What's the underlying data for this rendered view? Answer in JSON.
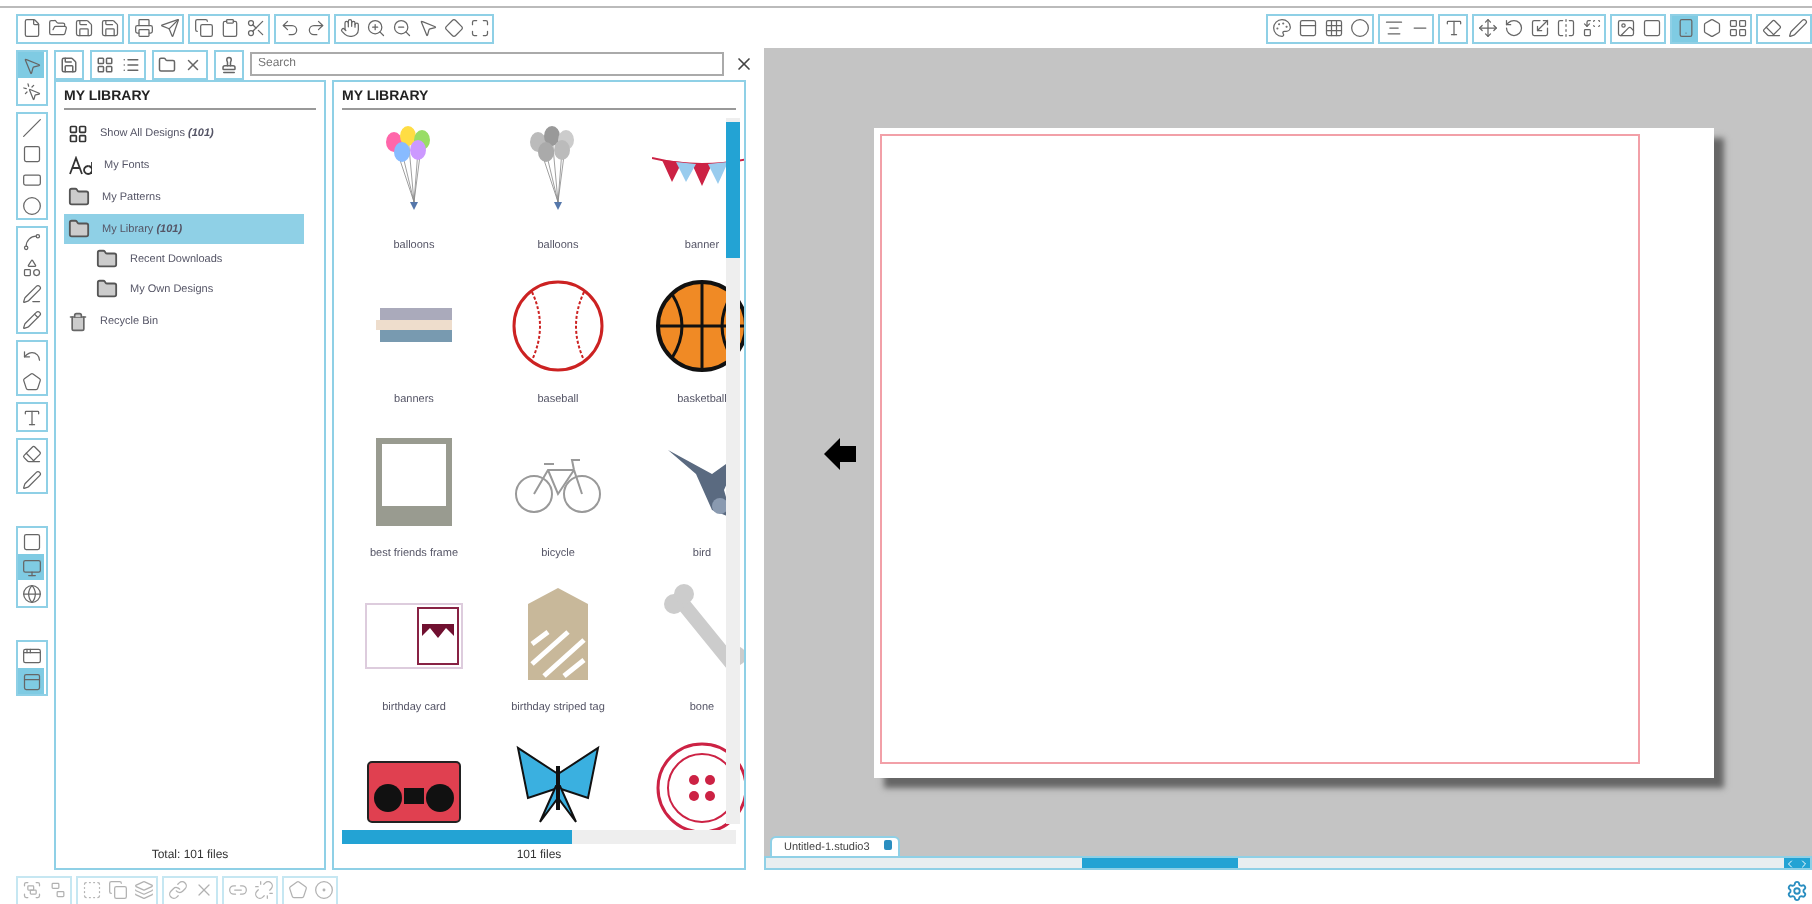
{
  "toolbar_top_left": [
    [
      {
        "selected": false
      },
      {
        "selected": false
      },
      {
        "selected": false
      },
      {
        "selected": false
      }
    ],
    [
      {
        "selected": false
      },
      {
        "selected": false
      }
    ],
    [
      {
        "selected": false
      },
      {
        "selected": false
      },
      {
        "selected": false
      }
    ],
    [
      {
        "selected": false
      },
      {
        "selected": false
      }
    ],
    [
      {
        "selected": false
      },
      {
        "selected": false
      },
      {
        "selected": false
      },
      {
        "selected": false
      },
      {
        "selected": false
      },
      {
        "selected": false
      }
    ]
  ],
  "toolbar_top_right": [
    [
      {
        "selected": false
      },
      {
        "selected": false
      },
      {
        "selected": false
      },
      {
        "selected": false
      }
    ],
    [
      {
        "selected": false
      },
      {
        "selected": false
      }
    ],
    [
      {
        "selected": false
      }
    ],
    [
      {
        "selected": false
      },
      {
        "selected": false
      },
      {
        "selected": false
      },
      {
        "selected": false
      },
      {
        "selected": false
      }
    ],
    [
      {
        "selected": false
      },
      {
        "selected": false
      }
    ],
    [
      {
        "selected": true
      },
      {
        "selected": false
      },
      {
        "selected": false
      }
    ],
    [
      {
        "selected": false
      },
      {
        "selected": false
      }
    ]
  ],
  "tool_strip": [
    [
      {
        "selected": true
      },
      {
        "selected": false
      }
    ],
    [
      {
        "selected": false
      },
      {
        "selected": false
      },
      {
        "selected": false
      },
      {
        "selected": false
      }
    ],
    [
      {
        "selected": false
      },
      {
        "selected": false
      },
      {
        "selected": false
      },
      {
        "selected": false
      }
    ],
    [
      {
        "selected": false
      },
      {
        "selected": false
      }
    ],
    [
      {
        "selected": false
      }
    ],
    [
      {
        "selected": false
      },
      {
        "selected": false
      }
    ],
    [
      {
        "selected": false
      },
      {
        "selected": true
      },
      {
        "selected": false
      }
    ],
    [
      {
        "selected": false
      },
      {
        "selected": true
      }
    ]
  ],
  "search": {
    "placeholder": "Search"
  },
  "library_tree": {
    "title": "MY LIBRARY",
    "total": "Total: 101 files",
    "items": [
      {
        "kind": "all",
        "label": "Show All Designs",
        "count": "(101)",
        "selected": false
      },
      {
        "kind": "fonts",
        "label": "My Fonts",
        "selected": false
      },
      {
        "kind": "folder",
        "label": "My Patterns",
        "selected": false
      },
      {
        "kind": "folder",
        "label": "My Library",
        "count": "(101)",
        "selected": true,
        "children": [
          {
            "kind": "folder",
            "label": "Recent Downloads",
            "selected": false
          },
          {
            "kind": "folder",
            "label": "My Own Designs",
            "selected": false
          }
        ]
      },
      {
        "kind": "bin",
        "label": "Recycle Bin",
        "selected": false
      }
    ]
  },
  "library_grid": {
    "title": "MY LIBRARY",
    "footer": "101 files",
    "items": [
      {
        "kind": "balloons-color",
        "label": "balloons"
      },
      {
        "kind": "balloons-gray",
        "label": "balloons"
      },
      {
        "kind": "banner",
        "label": "banner"
      },
      {
        "kind": "banners",
        "label": "banners"
      },
      {
        "kind": "baseball",
        "label": "baseball"
      },
      {
        "kind": "basketball",
        "label": "basketball"
      },
      {
        "kind": "frame",
        "label": "best friends frame"
      },
      {
        "kind": "bicycle",
        "label": "bicycle"
      },
      {
        "kind": "bird",
        "label": "bird"
      },
      {
        "kind": "card",
        "label": "birthday card"
      },
      {
        "kind": "tag",
        "label": "birthday striped tag"
      },
      {
        "kind": "bone",
        "label": "bone"
      },
      {
        "kind": "boombox"
      },
      {
        "kind": "butterfly"
      },
      {
        "kind": "button"
      }
    ]
  },
  "document_tab": {
    "label": "Untitled-1.studio3",
    "selected": true
  }
}
